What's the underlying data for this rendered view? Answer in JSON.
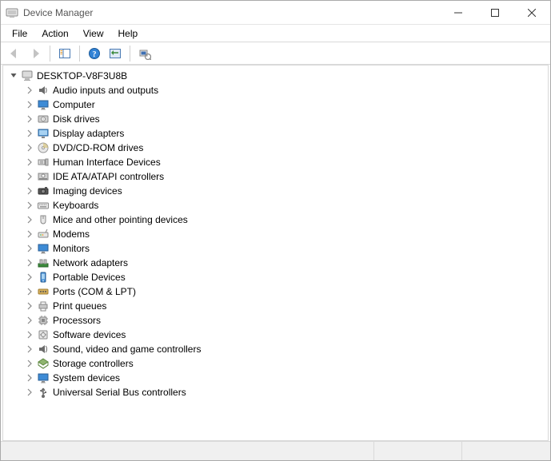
{
  "window": {
    "title": "Device Manager"
  },
  "menu": {
    "items": [
      "File",
      "Action",
      "View",
      "Help"
    ]
  },
  "toolbar": {
    "buttons": [
      {
        "name": "back",
        "enabled": false
      },
      {
        "name": "forward",
        "enabled": false
      },
      {
        "name": "show-hide-tree",
        "enabled": true
      },
      {
        "name": "help",
        "enabled": true
      },
      {
        "name": "show-hidden",
        "enabled": true
      },
      {
        "name": "scan-hardware",
        "enabled": true
      }
    ]
  },
  "tree": {
    "root": {
      "label": "DESKTOP-V8F3U8B",
      "icon": "computer",
      "expanded": true
    },
    "children": [
      {
        "label": "Audio inputs and outputs",
        "icon": "audio"
      },
      {
        "label": "Computer",
        "icon": "monitor"
      },
      {
        "label": "Disk drives",
        "icon": "disk"
      },
      {
        "label": "Display adapters",
        "icon": "display"
      },
      {
        "label": "DVD/CD-ROM drives",
        "icon": "dvd"
      },
      {
        "label": "Human Interface Devices",
        "icon": "hid"
      },
      {
        "label": "IDE ATA/ATAPI controllers",
        "icon": "ide"
      },
      {
        "label": "Imaging devices",
        "icon": "imaging"
      },
      {
        "label": "Keyboards",
        "icon": "keyboard"
      },
      {
        "label": "Mice and other pointing devices",
        "icon": "mouse"
      },
      {
        "label": "Modems",
        "icon": "modem"
      },
      {
        "label": "Monitors",
        "icon": "monitor"
      },
      {
        "label": "Network adapters",
        "icon": "network"
      },
      {
        "label": "Portable Devices",
        "icon": "portable"
      },
      {
        "label": "Ports (COM & LPT)",
        "icon": "port"
      },
      {
        "label": "Print queues",
        "icon": "printer"
      },
      {
        "label": "Processors",
        "icon": "cpu"
      },
      {
        "label": "Software devices",
        "icon": "software"
      },
      {
        "label": "Sound, video and game controllers",
        "icon": "sound"
      },
      {
        "label": "Storage controllers",
        "icon": "storage"
      },
      {
        "label": "System devices",
        "icon": "monitor"
      },
      {
        "label": "Universal Serial Bus controllers",
        "icon": "usb"
      }
    ]
  }
}
